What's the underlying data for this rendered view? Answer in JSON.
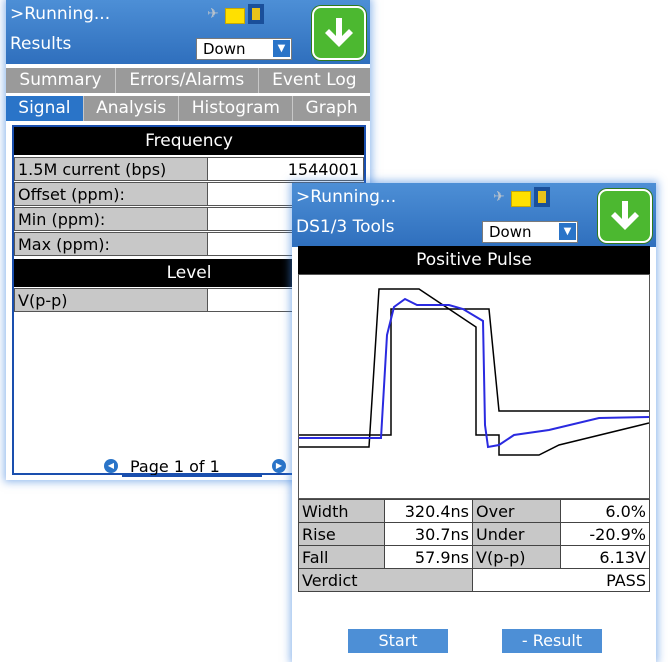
{
  "screen1": {
    "status": ">Running...",
    "title": "Results",
    "dropdown_value": "Down",
    "tabs_row1": [
      "Summary",
      "Errors/Alarms",
      "Event Log"
    ],
    "tabs_row2": [
      "Signal",
      "Analysis",
      "Histogram",
      "Graph"
    ],
    "active_tab": "Signal",
    "frequency_header": "Frequency",
    "rows": [
      {
        "label": "1.5M current (bps)",
        "value": "1544001"
      },
      {
        "label": "Offset (ppm):",
        "value": ""
      },
      {
        "label": "Min (ppm):",
        "value": ""
      },
      {
        "label": "Max (ppm):",
        "value": ""
      }
    ],
    "level_header": "Level",
    "level_rows": [
      {
        "label": "V(p-p)",
        "value": ""
      }
    ],
    "page_label": "Page 1 of 1"
  },
  "screen2": {
    "status": ">Running...",
    "title": "DS1/3 Tools",
    "dropdown_value": "Down",
    "section_title": "Positive Pulse",
    "measurements": [
      {
        "label": "Width",
        "value": "320.4ns",
        "label2": "Over",
        "value2": "6.0%"
      },
      {
        "label": "Rise",
        "value": "30.7ns",
        "label2": "Under",
        "value2": "-20.9%"
      },
      {
        "label": "Fall",
        "value": "57.9ns",
        "label2": "V(p-p)",
        "value2": "6.13V"
      }
    ],
    "verdict_label": "Verdict",
    "verdict_value": "PASS",
    "start_button": "Start",
    "result_button": "- Result"
  },
  "colors": {
    "header_blue": "#2f6fbd",
    "tab_active": "#2a74c8",
    "tab_inactive": "#9a9a9a",
    "go_green": "#4cb830",
    "trace_blue": "#2a2ae0",
    "mask_black": "#000000"
  },
  "icons": [
    "tool-icon",
    "folder-icon",
    "plug-icon",
    "arrow-down-icon",
    "chevron-down-icon",
    "prev-page-icon",
    "next-page-icon"
  ]
}
